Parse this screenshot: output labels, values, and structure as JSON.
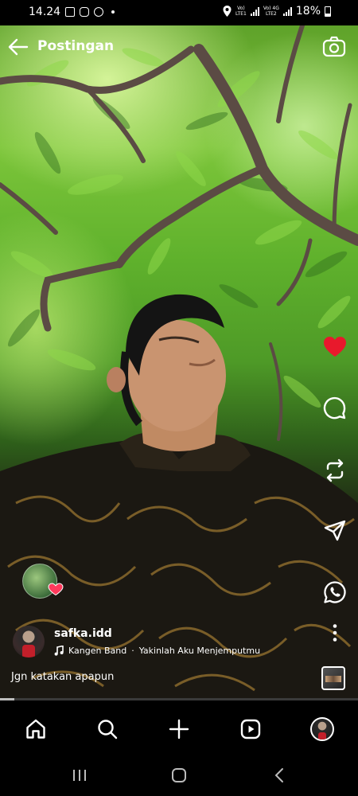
{
  "status_bar": {
    "time": "14.24",
    "sim1_label_top": "Vo)",
    "sim1_label_bottom": "LTE1",
    "sim2_label_top": "Vo) 4G",
    "sim2_label_bottom": "LTE2",
    "battery": "18%"
  },
  "header": {
    "title": "Postingan",
    "back_icon": "arrow-left-icon",
    "camera_icon": "camera-icon"
  },
  "actions": {
    "like_icon": "heart-filled-icon",
    "like_color": "#e8192c",
    "comment_icon": "comment-icon",
    "repost_icon": "repost-icon",
    "share_icon": "send-icon",
    "whatsapp_icon": "whatsapp-icon",
    "more_icon": "more-vertical-icon"
  },
  "post": {
    "username": "safka.idd",
    "music_artist": "Kangen Band",
    "music_separator": "·",
    "music_title": "Yakinlah Aku Menjemputmu",
    "caption": "Jgn katakan  apapun",
    "progress": 0.04
  },
  "bottom_nav": {
    "items": [
      "home-icon",
      "search-icon",
      "plus-icon",
      "reels-icon",
      "profile-avatar"
    ]
  },
  "system_nav": {
    "items": [
      "recents-icon",
      "home-circle-icon",
      "back-chevron-icon"
    ]
  }
}
